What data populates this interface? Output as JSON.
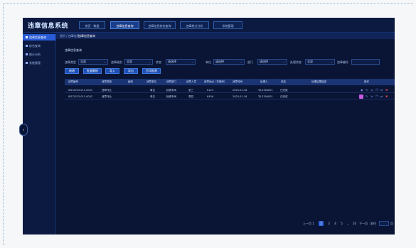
{
  "app": {
    "title": "违章信息系统"
  },
  "top_tabs": [
    {
      "label": "首页 · 数据"
    },
    {
      "label": "违章信息查询"
    },
    {
      "label": "违章信息综合查询"
    },
    {
      "label": "违章统计分析"
    },
    {
      "label": "系统管理"
    }
  ],
  "sidebar": {
    "items": [
      {
        "label": "违章信息查询"
      },
      {
        "label": "综合查询"
      },
      {
        "label": "统计分析"
      },
      {
        "label": "系统管理"
      }
    ]
  },
  "breadcrumb": {
    "home": "首页 / 违章信息",
    "current": "违章信息查询"
  },
  "section": {
    "title": "违章信息查询"
  },
  "filters": [
    {
      "label": "违章类型",
      "value": "全部"
    },
    {
      "label": "违章级别",
      "value": "全部"
    },
    {
      "label": "状态",
      "value": "请选择"
    },
    {
      "label": "单位",
      "value": "请选择"
    },
    {
      "label": "部门",
      "value": "请选择"
    },
    {
      "label": "处理状态",
      "value": "全部"
    }
  ],
  "search": {
    "label": "违章编号",
    "placeholder": ""
  },
  "actions": [
    {
      "label": "新增"
    },
    {
      "label": "批量删除"
    },
    {
      "label": "导入"
    },
    {
      "label": "导出"
    },
    {
      "label": "打印报表"
    }
  ],
  "table": {
    "columns": [
      "违章编号",
      "违章类型",
      "级别",
      "违章单位",
      "违章部门",
      "违章人员",
      "违章地点（车厢号）",
      "违章时间",
      "处理人",
      "状态",
      "处理结果描述",
      "操作"
    ],
    "rows": [
      {
        "id": "WZ-2023-011-0001",
        "type": "违章作业",
        "level": "",
        "unit": "单位",
        "dept": "检修车间",
        "person": "张三",
        "location": "K123",
        "date": "2023-01-16",
        "handler": "TJL2304001",
        "status": "已完成"
      },
      {
        "id": "WZ-2023-011-0002",
        "type": "违章作业",
        "level": "",
        "unit": "单位",
        "dept": "检修车间",
        "person": "李四",
        "location": "K456",
        "date": "2023-01-16",
        "handler": "TJL2304001",
        "status": "已完成"
      }
    ]
  },
  "pagination": {
    "prev_label": "上一页",
    "pages": [
      "1",
      "2",
      "3",
      "4",
      "5",
      "...",
      "10"
    ],
    "active_page": "2",
    "next_label": "下一页",
    "goto_label": "前往",
    "goto_value": "",
    "page_suffix": "页"
  }
}
